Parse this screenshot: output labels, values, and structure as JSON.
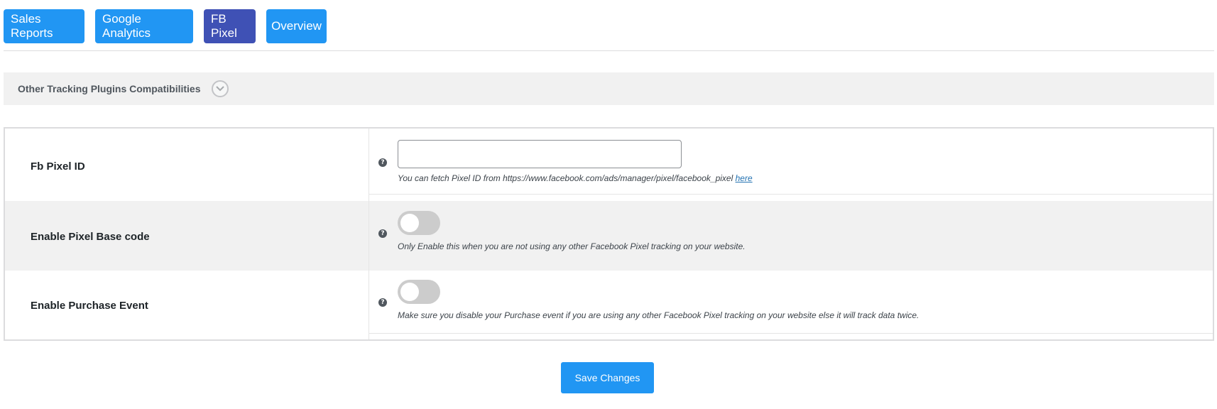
{
  "tabs": [
    {
      "label": "Sales Reports"
    },
    {
      "label": "Google Analytics"
    },
    {
      "label": "FB Pixel",
      "active": true
    },
    {
      "label": "Overview"
    }
  ],
  "collapse": {
    "title": "Other Tracking Plugins Compatibilities",
    "icon": "chevron-down-icon"
  },
  "settings": {
    "pixel_id": {
      "label": "Fb Pixel ID",
      "value": "",
      "help": "?",
      "description": "You can fetch Pixel ID from https://www.facebook.com/ads/manager/pixel/facebook_pixel",
      "link_text": "here"
    },
    "base_code": {
      "label": "Enable Pixel Base code",
      "enabled": false,
      "help": "?",
      "description": "Only Enable this when you are not using any other Facebook Pixel tracking on your website."
    },
    "purchase_event": {
      "label": "Enable Purchase Event",
      "enabled": false,
      "help": "?",
      "description": "Make sure you disable your Purchase event if you are using any other Facebook Pixel tracking on your website else it will track data twice."
    }
  },
  "save_label": "Save Changes",
  "colors": {
    "tab": "#2196f3",
    "tab_active": "#3f51b5",
    "toggle_off": "#cccccc"
  }
}
